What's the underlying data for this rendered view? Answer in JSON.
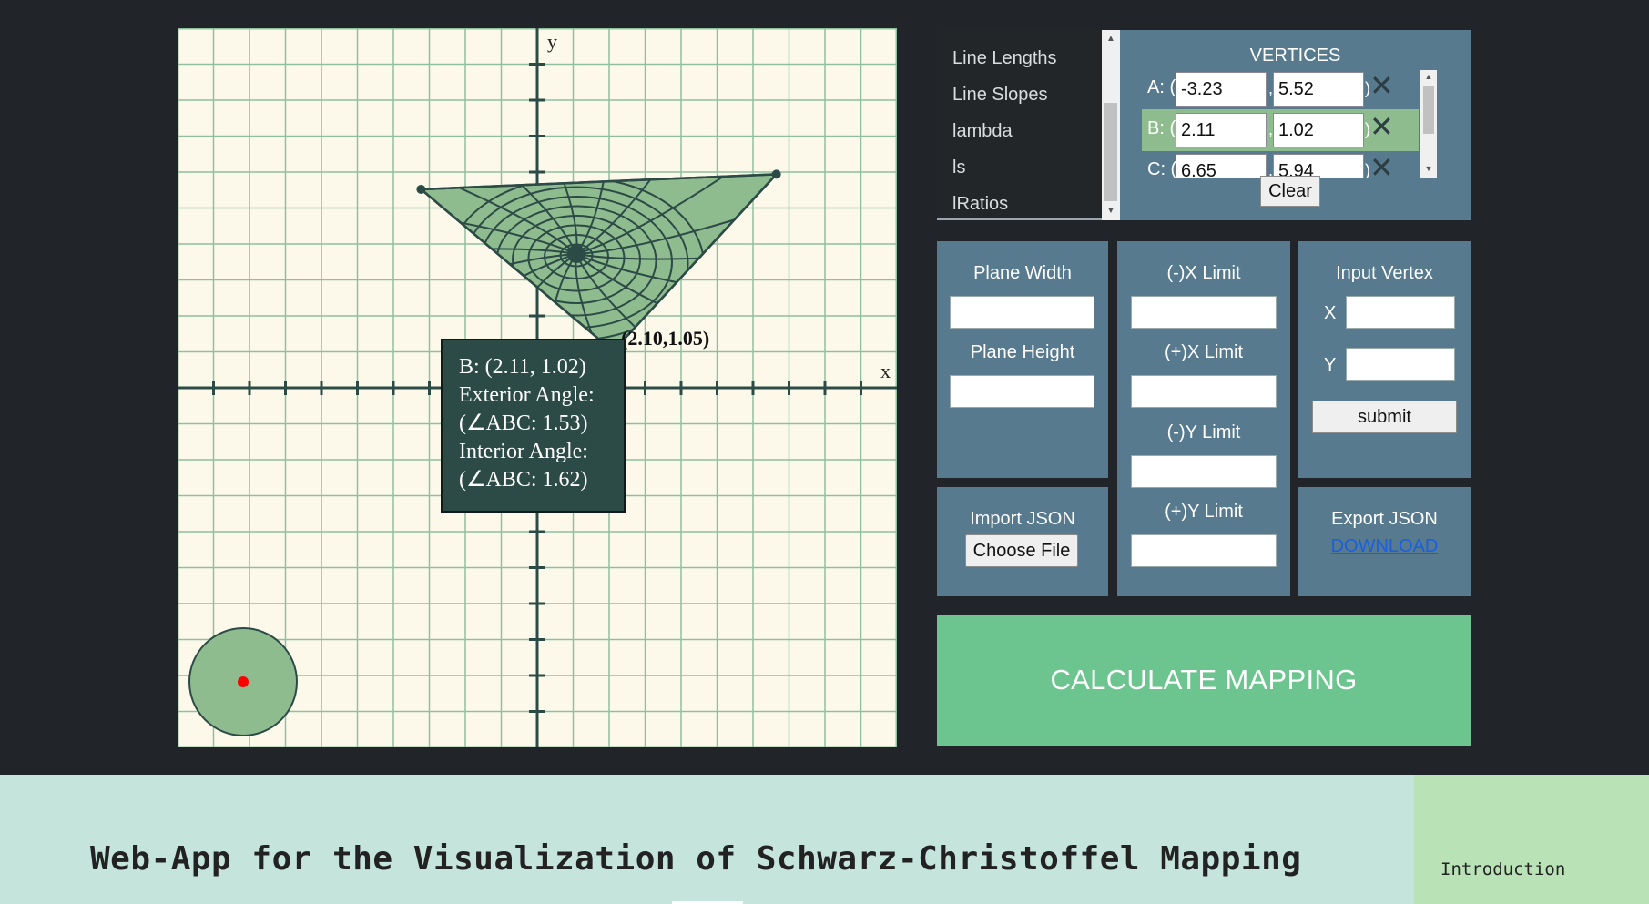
{
  "plane": {
    "axis_x_label": "x",
    "axis_y_label": "y",
    "vertex_point_label": "(2.10,1.05)",
    "colors": {
      "background": "#fdf9ea",
      "grid": "#8fbf9f",
      "axis": "#2c4a46",
      "polygon": "#8fbc8f",
      "point": "#ff0000"
    },
    "tooltip": {
      "line1": "B: (2.11, 1.02)",
      "line2": "Exterior Angle:",
      "line3": "(∠ABC: 1.53)",
      "line4": "Interior Angle:",
      "line5": "(∠ABC: 1.62)"
    }
  },
  "menu": {
    "items": [
      "Line Lengths",
      "Line Slopes",
      "lambda",
      "ls",
      "lRatios"
    ]
  },
  "vertices": {
    "title": "VERTICES",
    "rows": [
      {
        "label": "A: (",
        "x": "-3.23",
        "y": "5.52",
        "sep": ",",
        "close": ")"
      },
      {
        "label": "B: (",
        "x": "2.11",
        "y": "1.02",
        "sep": ",",
        "close": ")"
      },
      {
        "label": "C: (",
        "x": "6.65",
        "y": "5.94",
        "sep": ",",
        "close": ")"
      }
    ],
    "delete_symbol": "✕",
    "clear_label": "Clear"
  },
  "plane_size": {
    "width_label": "Plane Width",
    "height_label": "Plane Height"
  },
  "limits": {
    "neg_x_label": "(-)X Limit",
    "pos_x_label": "(+)X Limit",
    "neg_y_label": "(-)Y Limit",
    "pos_y_label": "(+)Y Limit"
  },
  "input_vertex": {
    "title": "Input Vertex",
    "x_label": "X",
    "y_label": "Y",
    "submit_label": "submit"
  },
  "import": {
    "title": "Import JSON",
    "button_label": "Choose File"
  },
  "export": {
    "title": "Export JSON",
    "link_label": "DOWNLOAD"
  },
  "calculate_label": "CALCULATE MAPPING",
  "footer": {
    "title": "Web-App for the Visualization of Schwarz-Christoffel Mapping",
    "intro_tab": "Introduction"
  }
}
